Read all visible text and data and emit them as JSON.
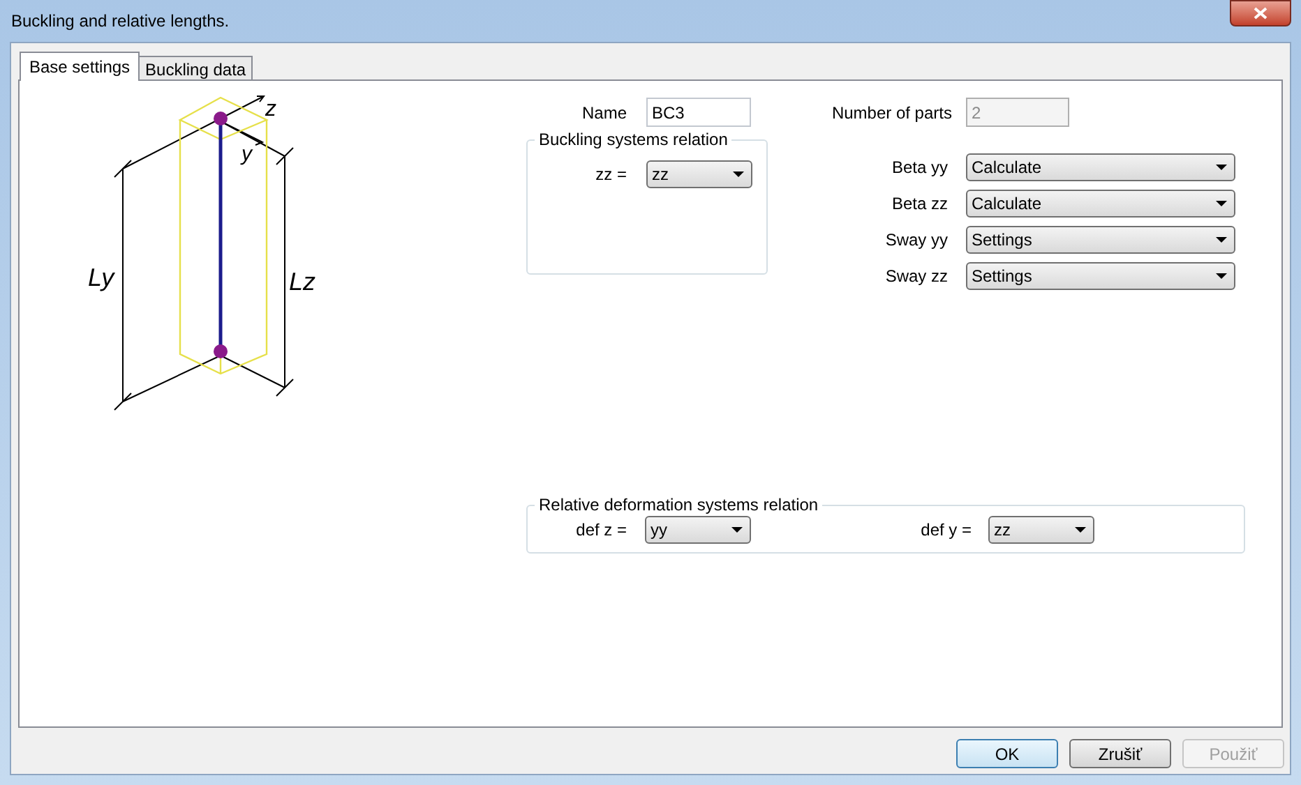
{
  "window": {
    "title": "Buckling and relative lengths."
  },
  "tabs": [
    {
      "label": "Base settings",
      "selected": true
    },
    {
      "label": "Buckling data",
      "selected": false
    }
  ],
  "drawing": {
    "axis_labels": [
      "z",
      "y"
    ],
    "dimension_labels": [
      "Ly",
      "Lz"
    ]
  },
  "name": {
    "label": "Name",
    "value": "BC3",
    "disabled": false
  },
  "number_of_parts": {
    "label": "Number of parts",
    "value": "2",
    "disabled": true
  },
  "buckling_systems_relation": {
    "title": "Buckling systems relation",
    "fields": [
      {
        "label": "zz =",
        "value": "zz"
      }
    ]
  },
  "settings": [
    {
      "label": "Beta yy",
      "value": "Calculate"
    },
    {
      "label": "Beta zz",
      "value": "Calculate"
    },
    {
      "label": "Sway yy",
      "value": "Settings"
    },
    {
      "label": "Sway zz",
      "value": "Settings"
    }
  ],
  "relative_deformation": {
    "title": "Relative deformation systems relation",
    "fields": [
      {
        "label": "def z =",
        "value": "yy"
      },
      {
        "label": "def y =",
        "value": "zz"
      }
    ]
  },
  "buttons": [
    {
      "label": "OK",
      "default": true,
      "disabled": false
    },
    {
      "label": "Zrušiť",
      "default": false,
      "disabled": false
    },
    {
      "label": "Použiť",
      "default": false,
      "disabled": true
    }
  ]
}
